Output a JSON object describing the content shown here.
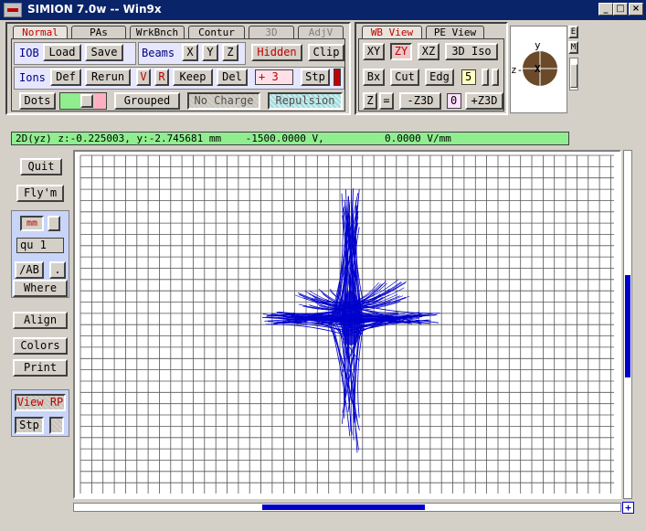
{
  "window": {
    "title": "SIMION 7.0w -- Win9x",
    "buttons": [
      "_",
      "□",
      "×"
    ]
  },
  "top_tabs": [
    "Normal",
    "PAs",
    "WrkBnch",
    "Contur",
    "3D",
    "AdjV"
  ],
  "row1": {
    "iob": "IOB",
    "load": "Load",
    "save": "Save",
    "beams": "Beams",
    "x": "X",
    "y": "Y",
    "z": "Z",
    "hidden": "Hidden",
    "clip": "Clip"
  },
  "row2": {
    "ions": "Ions",
    "def": "Def",
    "rerun": "Rerun",
    "v": "V",
    "r": "R",
    "keep": "Keep",
    "del": "Del",
    "count": "+ 3",
    "stp": "Stp"
  },
  "row3": {
    "dots": "Dots",
    "grouped": "Grouped",
    "nocharge": "No Charge",
    "repulsion": "Repulsion"
  },
  "view_tabs": [
    "WB View",
    "PE View"
  ],
  "view": {
    "xy": "XY",
    "zy": "ZY",
    "xz": "XZ",
    "iso": "3D Iso",
    "bx": "Bx",
    "cut": "Cut",
    "edg": "Edg",
    "num5": "5",
    "z": "Z",
    "eq": "=",
    "minusz3d": "-Z3D",
    "zero": "0",
    "plusz3d": "+Z3D"
  },
  "orient": {
    "y": "y",
    "z": "z-",
    "x": "X",
    "e": "E",
    "m": "M"
  },
  "status": "2D(yz) z:-0.225003, y:-2.745681 mm    -1500.0000 V,          0.0000 V/mm",
  "side": {
    "quit": "Quit",
    "flym": "Fly'm",
    "mm": "mm",
    "qu": "qu  1",
    "ab": "/AB",
    "dot": ".",
    "where": "Where",
    "align": "Align",
    "colors": "Colors",
    "print": "Print",
    "viewrp": "View RP",
    "stp": "Stp"
  },
  "colors": {
    "title": "#0a246a",
    "trajectory": "#0000cc",
    "status": "#90ee90",
    "grid": "#555555"
  }
}
